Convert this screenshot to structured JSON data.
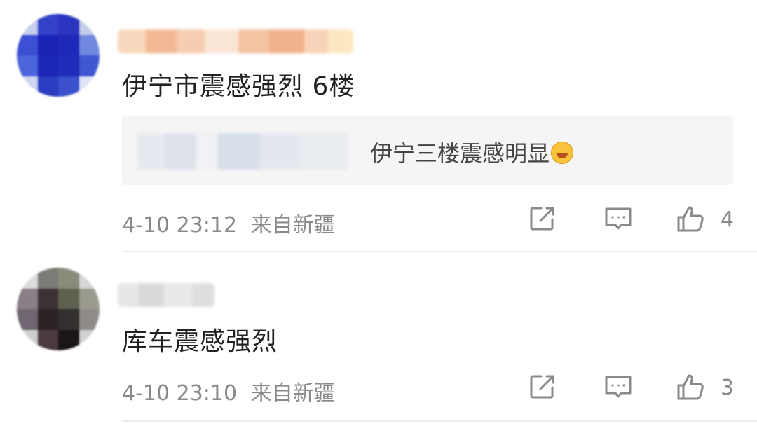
{
  "comments": [
    {
      "text": "伊宁市震感强烈 6楼",
      "quote": {
        "text": "伊宁三楼震感明显"
      },
      "time": "4-10 23:12",
      "location": "来自新疆",
      "likes": "4"
    },
    {
      "text": "库车震感强烈",
      "time": "4-10 23:10",
      "location": "来自新疆",
      "likes": "3"
    }
  ],
  "icons": [
    "share-icon",
    "comment-icon",
    "like-icon",
    "laughing-crying-emoji-icon"
  ],
  "colors": {
    "text": "#222222",
    "meta": "#8a8a8a",
    "quote_bg": "#f5f5f5",
    "icon": "#8a8a8a"
  }
}
